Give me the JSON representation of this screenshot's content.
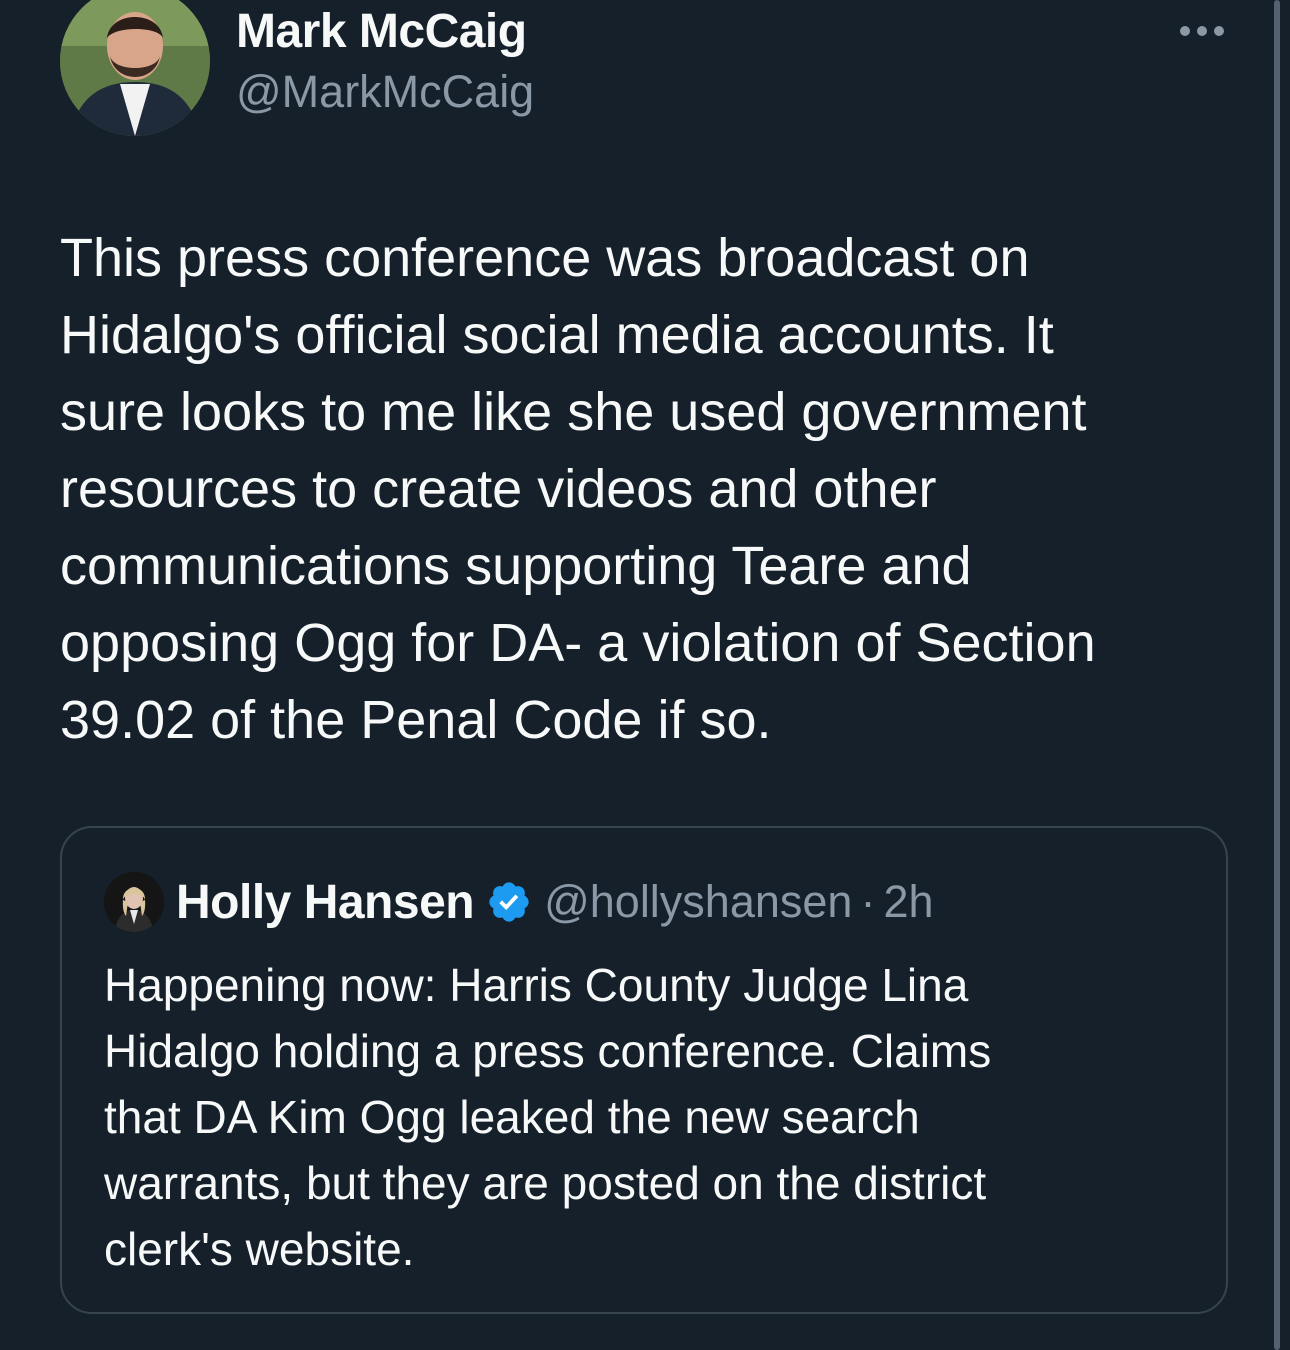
{
  "author": {
    "display_name": "Mark McCaig",
    "handle": "@MarkMcCaig",
    "avatar_icon": "profile-photo-icon"
  },
  "more_icon": "more-options-icon",
  "tweet": {
    "text": "This press conference was broadcast on\nHidalgo's official social media accounts. It\nsure looks to me like she used government\nresources to create videos and other\ncommunications supporting Teare and\nopposing Ogg for DA- a violation of Section\n39.02 of the Penal Code if so."
  },
  "quoted_tweet": {
    "display_name": "Holly Hansen",
    "verified": true,
    "verified_icon": "verified-badge-icon",
    "handle": "@hollyshansen",
    "separator": "·",
    "time": "2h",
    "text": "Happening now: Harris County Judge Lina\nHidalgo holding a press conference. Claims\nthat DA Kim Ogg leaked the new search\nwarrants, but they are posted on the district\nclerk's website."
  },
  "colors": {
    "background": "#15202b",
    "primary_text": "#f7f9f9",
    "secondary_text": "#8b98a5",
    "border": "#38444d",
    "verified_blue": "#1d9bf0"
  }
}
